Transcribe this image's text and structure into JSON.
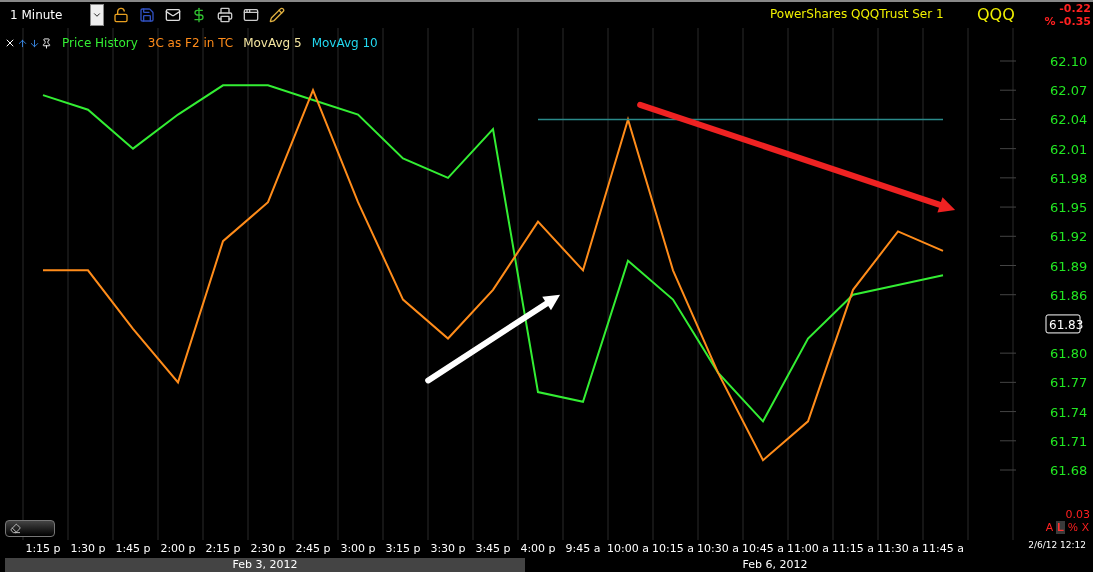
{
  "toolbar": {
    "interval": "1 Minute"
  },
  "header": {
    "name": "PowerShares QQQTrust Ser 1",
    "symbol": "QQQ",
    "change": "-0.22",
    "change_pct": "% -0.35"
  },
  "legend": [
    {
      "label": "MovAvg 5",
      "color": "#f5e6a0"
    },
    {
      "label": "MovAvg 10",
      "color": "#22d8f0"
    }
  ],
  "chart": {
    "last_price": "61.83",
    "chart_data": {
      "type": "line",
      "categories": [
        "1:15 p",
        "1:30 p",
        "1:45 p",
        "2:00 p",
        "2:15 p",
        "2:30 p",
        "2:45 p",
        "3:00 p",
        "3:15 p",
        "3:30 p",
        "3:45 p",
        "4:00 p",
        "9:45 a",
        "10:00 a",
        "10:15 a",
        "10:30 a",
        "10:45 a",
        "11:00 a",
        "11:15 a",
        "11:30 a",
        "11:45 a"
      ],
      "series": [
        {
          "name": "Price History",
          "color": "#33ee33",
          "values": [
            62.065,
            62.05,
            62.01,
            62.045,
            62.075,
            62.075,
            62.06,
            62.045,
            62.0,
            61.98,
            62.03,
            61.76,
            61.75,
            61.895,
            61.855,
            61.78,
            61.73,
            61.815,
            61.86,
            61.87,
            61.88
          ]
        },
        {
          "name": "3C as F2 in TC",
          "color": "#ff8c1a",
          "values": [
            61.885,
            61.885,
            61.825,
            61.77,
            61.915,
            61.955,
            62.07,
            61.955,
            61.855,
            61.815,
            61.865,
            61.935,
            61.885,
            62.04,
            61.885,
            61.78,
            61.69,
            61.73,
            61.865,
            61.925,
            61.905
          ]
        },
        {
          "color": "#2a8a8a",
          "values": [
            null,
            null,
            null,
            null,
            null,
            null,
            null,
            null,
            null,
            null,
            null,
            62.04,
            62.04,
            62.04,
            62.04,
            62.04,
            62.04,
            62.04,
            62.04,
            62.04,
            62.04
          ]
        }
      ],
      "yticks": [
        {
          "value": 62.1,
          "label": "62.10"
        },
        {
          "value": 62.07,
          "label": "62.07"
        },
        {
          "value": 62.04,
          "label": "62.04"
        },
        {
          "value": 62.01,
          "label": "62.01"
        },
        {
          "value": 61.98,
          "label": "61.98"
        },
        {
          "value": 61.95,
          "label": "61.95"
        },
        {
          "value": 61.92,
          "label": "61.92"
        },
        {
          "value": 61.89,
          "label": "61.89"
        },
        {
          "value": 61.86,
          "label": "61.86"
        },
        {
          "value": 61.8,
          "label": "61.80"
        },
        {
          "value": 61.77,
          "label": "61.77"
        },
        {
          "value": 61.74,
          "label": "61.74"
        },
        {
          "value": 61.71,
          "label": "61.71"
        },
        {
          "value": 61.68,
          "label": "61.68"
        }
      ],
      "ylim": [
        61.68,
        62.1
      ]
    }
  },
  "date_bar": [
    {
      "label": "Feb 3, 2012",
      "highlighted": true
    },
    {
      "label": "Feb 6, 2012",
      "highlighted": false
    }
  ],
  "corner": {
    "value": "0.03",
    "buttons": [
      {
        "label": "A",
        "selected": false
      },
      {
        "label": "L",
        "selected": true
      },
      {
        "label": "%",
        "selected": false
      },
      {
        "label": "X",
        "selected": false
      }
    ],
    "timestamp": "2/6/12 12:12"
  }
}
